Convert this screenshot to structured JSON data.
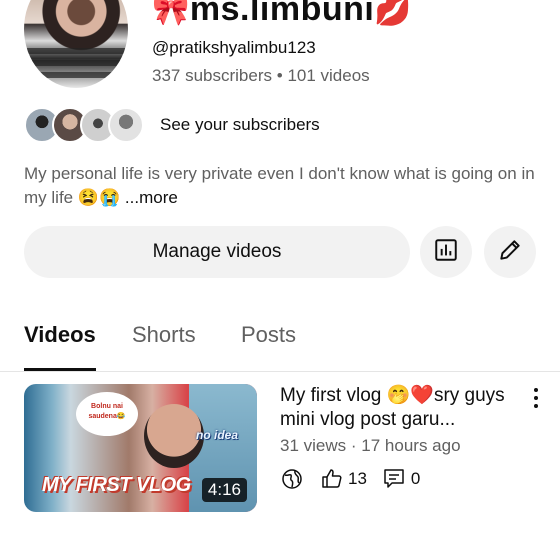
{
  "channel": {
    "name_prefix_emoji": "🎀",
    "name": "ms.limbuni",
    "name_suffix_emoji": "💋",
    "handle": "@pratikshyalimbu123",
    "subscribers": "337 subscribers",
    "separator": "•",
    "videos": "101 videos",
    "see_subscribers": "See your subscribers",
    "description": "My personal life is very private even I don't know what is going on in my life 😫😭",
    "more": " ...more"
  },
  "actions": {
    "manage_videos": "Manage videos",
    "analytics_icon": "bar-chart-icon",
    "edit_icon": "pencil-icon"
  },
  "tabs": [
    {
      "label": "Videos",
      "active": true
    },
    {
      "label": "Shorts",
      "active": false
    },
    {
      "label": "Posts",
      "active": false
    }
  ],
  "video": {
    "title": "My first vlog 🤭❤️sry guys mini vlog post garu...",
    "views": "31 views",
    "separator": "·",
    "age": "17 hours ago",
    "likes": "13",
    "comments": "0",
    "duration": "4:16",
    "thumbnail_text": "MY FIRST VLOG",
    "thumbnail_bubble": "Bolnu nai saudena😂",
    "thumbnail_tag": "no idea",
    "visibility_icon": "globe-icon"
  }
}
